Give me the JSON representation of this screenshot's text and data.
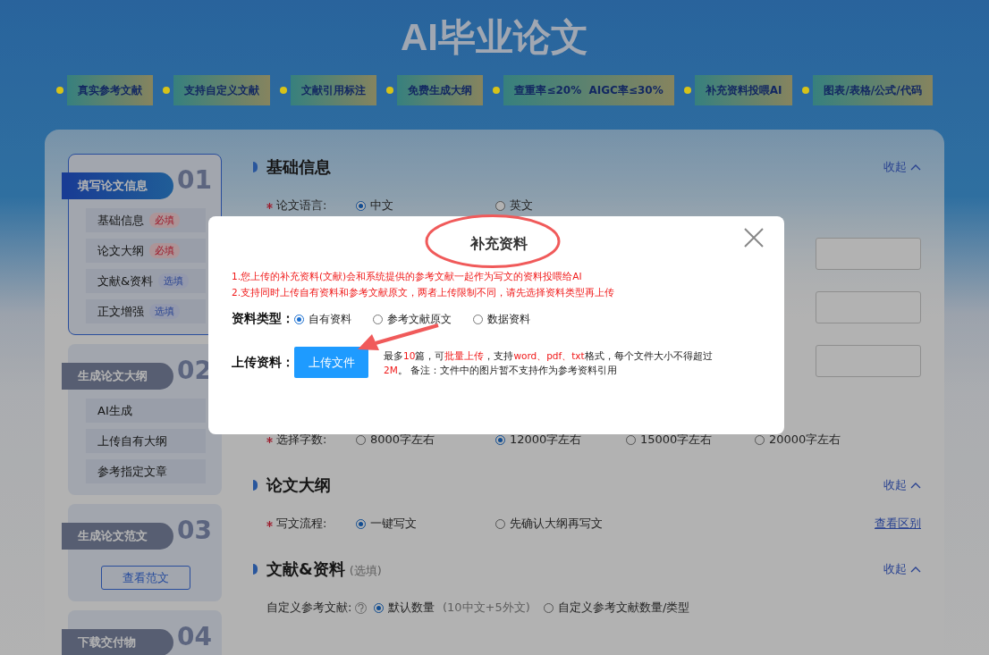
{
  "title": "AI毕业论文",
  "features": [
    "真实参考文献",
    "支持自定义文献",
    "文献引用标注",
    "免费生成大纲",
    "查重率≤20%  AIGC率≤30%",
    "补充资料投喂AI",
    "图表/表格/公式/代码"
  ],
  "sidebar": {
    "groups": [
      {
        "title": "填写论文信息",
        "number": "01",
        "active": true,
        "items": [
          {
            "label": "基础信息",
            "badge": {
              "text": "必填",
              "kind": "required"
            }
          },
          {
            "label": "论文大纲",
            "badge": {
              "text": "必填",
              "kind": "required"
            }
          },
          {
            "label": "文献&资料",
            "badge": {
              "text": "选填",
              "kind": "optional"
            }
          },
          {
            "label": "正文增强",
            "badge": {
              "text": "选填",
              "kind": "optional"
            }
          }
        ]
      },
      {
        "title": "生成论文大纲",
        "number": "02",
        "active": false,
        "items": [
          {
            "label": "AI生成"
          },
          {
            "label": "上传自有大纲"
          },
          {
            "label": "参考指定文章"
          }
        ]
      },
      {
        "title": "生成论文范文",
        "number": "03",
        "active": false,
        "button": "查看范文"
      },
      {
        "title": "下载交付物",
        "number": "04",
        "active": false
      }
    ]
  },
  "form": {
    "sections": [
      {
        "title": "基础信息",
        "collapse": "收起",
        "rows": [
          {
            "kind": "radio",
            "label": "论文语言:",
            "required": true,
            "options": [
              {
                "label": "中文",
                "selected": true
              },
              {
                "label": "英文",
                "selected": false
              }
            ]
          },
          {
            "kind": "field"
          },
          {
            "kind": "field"
          },
          {
            "kind": "field"
          },
          {
            "kind": "radio",
            "label": "选择字数:",
            "required": true,
            "options": [
              {
                "label": "8000字左右",
                "selected": false
              },
              {
                "label": "12000字左右",
                "selected": true
              },
              {
                "label": "15000字左右",
                "selected": false
              },
              {
                "label": "20000字左右",
                "selected": false
              }
            ]
          }
        ]
      },
      {
        "title": "论文大纲",
        "collapse": "收起",
        "rows": [
          {
            "kind": "radio",
            "label": "写文流程:",
            "required": true,
            "options": [
              {
                "label": "一键写文",
                "selected": true
              },
              {
                "label": "先确认大纲再写文",
                "selected": false
              }
            ],
            "link": "查看区别"
          }
        ]
      },
      {
        "title": "文献&资料",
        "note": "(选填)",
        "collapse": "收起",
        "rows": [
          {
            "kind": "radio",
            "label": "自定义参考文献:",
            "required": false,
            "help": true,
            "options": [
              {
                "label": "默认数量",
                "hint": "(10中文+5外文)",
                "selected": true
              },
              {
                "label": "自定义参考文献数量/类型",
                "selected": false
              }
            ]
          }
        ]
      }
    ]
  },
  "dialog": {
    "title": "补充资料",
    "notes": [
      "1.您上传的补充资料(文献)会和系统提供的参考文献一起作为写文的资料投喂给AI",
      "2.支持同时上传自有资料和参考文献原文，两者上传限制不同，请先选择资料类型再上传"
    ],
    "type_label": "资料类型：",
    "types": [
      {
        "label": "自有资料",
        "selected": true
      },
      {
        "label": "参考文献原文",
        "selected": false
      },
      {
        "label": "数据资料",
        "selected": false
      }
    ],
    "upload_label": "上传资料：",
    "upload_button": "上传文件",
    "upload_note": [
      {
        "text": "最多",
        "highlight": false
      },
      {
        "text": "10",
        "highlight": true
      },
      {
        "text": "篇，可",
        "highlight": false
      },
      {
        "text": "批量上传",
        "highlight": true
      },
      {
        "text": "，支持",
        "highlight": false
      },
      {
        "text": "word、pdf、txt",
        "highlight": true
      },
      {
        "text": "格式，每个文件大小不得超过",
        "highlight": false
      },
      {
        "text": "2M",
        "highlight": true
      },
      {
        "text": "。 备注：文件中的图片暂不支持作为参考资料引用",
        "highlight": false
      }
    ]
  }
}
